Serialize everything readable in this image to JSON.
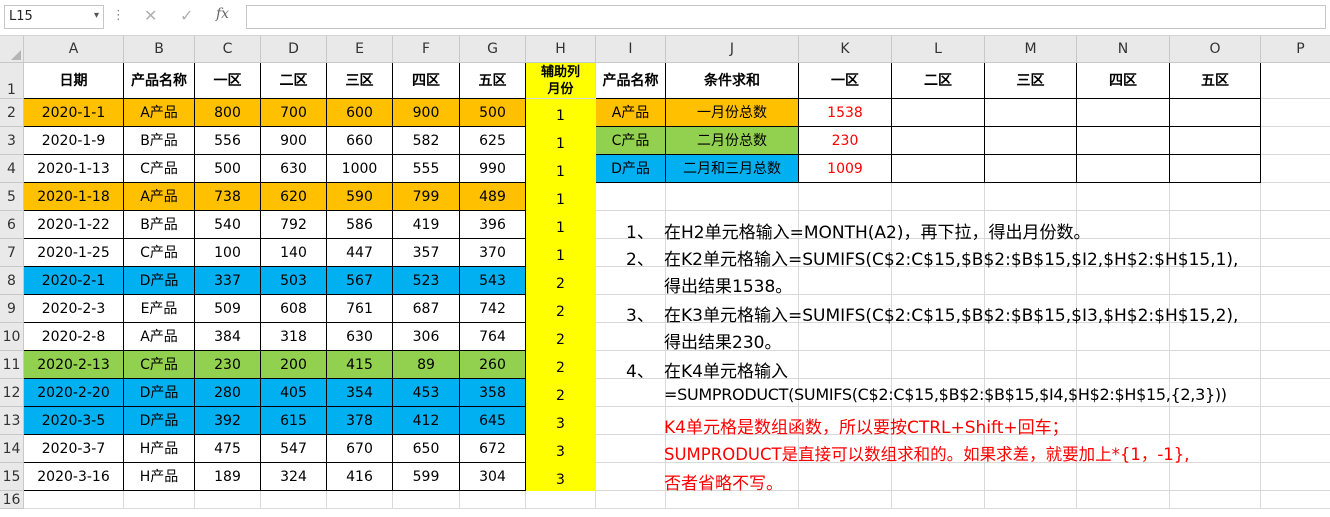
{
  "formula_bar": {
    "name_box": "L15",
    "name_box_arrow": "▾",
    "dots": "⋮",
    "cancel": "✕",
    "enter": "✓",
    "fx": "fx",
    "formula": ""
  },
  "columns": [
    "A",
    "B",
    "C",
    "D",
    "E",
    "F",
    "G",
    "H",
    "I",
    "J",
    "K",
    "L",
    "M",
    "N",
    "O",
    "P"
  ],
  "rows": [
    "1",
    "2",
    "3",
    "4",
    "5",
    "6",
    "7",
    "8",
    "9",
    "10",
    "11",
    "12",
    "13",
    "14",
    "15",
    "16"
  ],
  "table": {
    "headers": [
      "日期",
      "产品名称",
      "一区",
      "二区",
      "三区",
      "四区",
      "五区"
    ],
    "helper_header_line1": "辅助列",
    "helper_header_line2": "月份",
    "data": [
      [
        "2020-1-1",
        "A产品",
        "800",
        "700",
        "600",
        "900",
        "500",
        "1"
      ],
      [
        "2020-1-9",
        "B产品",
        "556",
        "900",
        "660",
        "582",
        "625",
        "1"
      ],
      [
        "2020-1-13",
        "C产品",
        "500",
        "630",
        "1000",
        "555",
        "990",
        "1"
      ],
      [
        "2020-1-18",
        "A产品",
        "738",
        "620",
        "590",
        "799",
        "489",
        "1"
      ],
      [
        "2020-1-22",
        "B产品",
        "540",
        "792",
        "586",
        "419",
        "396",
        "1"
      ],
      [
        "2020-1-25",
        "C产品",
        "100",
        "140",
        "447",
        "357",
        "370",
        "1"
      ],
      [
        "2020-2-1",
        "D产品",
        "337",
        "503",
        "567",
        "523",
        "543",
        "2"
      ],
      [
        "2020-2-3",
        "E产品",
        "509",
        "608",
        "761",
        "687",
        "742",
        "2"
      ],
      [
        "2020-2-8",
        "A产品",
        "384",
        "318",
        "630",
        "306",
        "764",
        "2"
      ],
      [
        "2020-2-13",
        "C产品",
        "230",
        "200",
        "415",
        "89",
        "260",
        "2"
      ],
      [
        "2020-2-20",
        "D产品",
        "280",
        "405",
        "354",
        "453",
        "358",
        "2"
      ],
      [
        "2020-3-5",
        "D产品",
        "392",
        "615",
        "378",
        "412",
        "645",
        "3"
      ],
      [
        "2020-3-7",
        "H产品",
        "475",
        "547",
        "670",
        "650",
        "672",
        "3"
      ],
      [
        "2020-3-16",
        "H产品",
        "189",
        "324",
        "416",
        "599",
        "304",
        "3"
      ]
    ],
    "row_fill": [
      "orange",
      "",
      "",
      "orange",
      "",
      "",
      "blue",
      "",
      "",
      "green",
      "blue",
      "blue",
      "",
      ""
    ]
  },
  "summary": {
    "headers": [
      "产品名称",
      "条件求和",
      "一区",
      "二区",
      "三区",
      "四区",
      "五区"
    ],
    "rows": [
      {
        "product": "A产品",
        "condition": "一月份总数",
        "value": "1538",
        "fill": "orange"
      },
      {
        "product": "C产品",
        "condition": "二月份总数",
        "value": "230",
        "fill": "green"
      },
      {
        "product": "D产品",
        "condition": "二月和三月总数",
        "value": "1009",
        "fill": "blue"
      }
    ]
  },
  "notes": {
    "n1_num": "1、",
    "n1_text": "在H2单元格输入=MONTH(A2)，再下拉，得出月份数。",
    "n2_num": "2、",
    "n2_text": "在K2单元格输入=SUMIFS(C$2:C$15,$B$2:$B$15,$I2,$H$2:$H$15,1),",
    "n2_text2": "得出结果1538。",
    "n3_num": "3、",
    "n3_text": "在K3单元格输入=SUMIFS(C$2:C$15,$B$2:$B$15,$I3,$H$2:$H$15,2),",
    "n3_text2": "得出结果230。",
    "n4_num": "4、",
    "n4_text": "在K4单元格输入",
    "n4_text2": "=SUMPRODUCT(SUMIFS(C$2:C$15,$B$2:$B$15,$I4,$H$2:$H$15,{2,3}))",
    "n4_red1": "K4单元格是数组函数，所以要按CTRL+Shift+回车；",
    "n4_red2": "SUMPRODUCT是直接可以数组求和的。如果求差，就要加上*{1，-1},",
    "n4_red3": "否者省略不写。"
  },
  "colors": {
    "orange": "#ffc000",
    "blue": "#00b0f0",
    "green": "#92d050",
    "yellow": "#ffff00",
    "header_gray": "#e9e9e9",
    "red_text": "#ff0000"
  }
}
